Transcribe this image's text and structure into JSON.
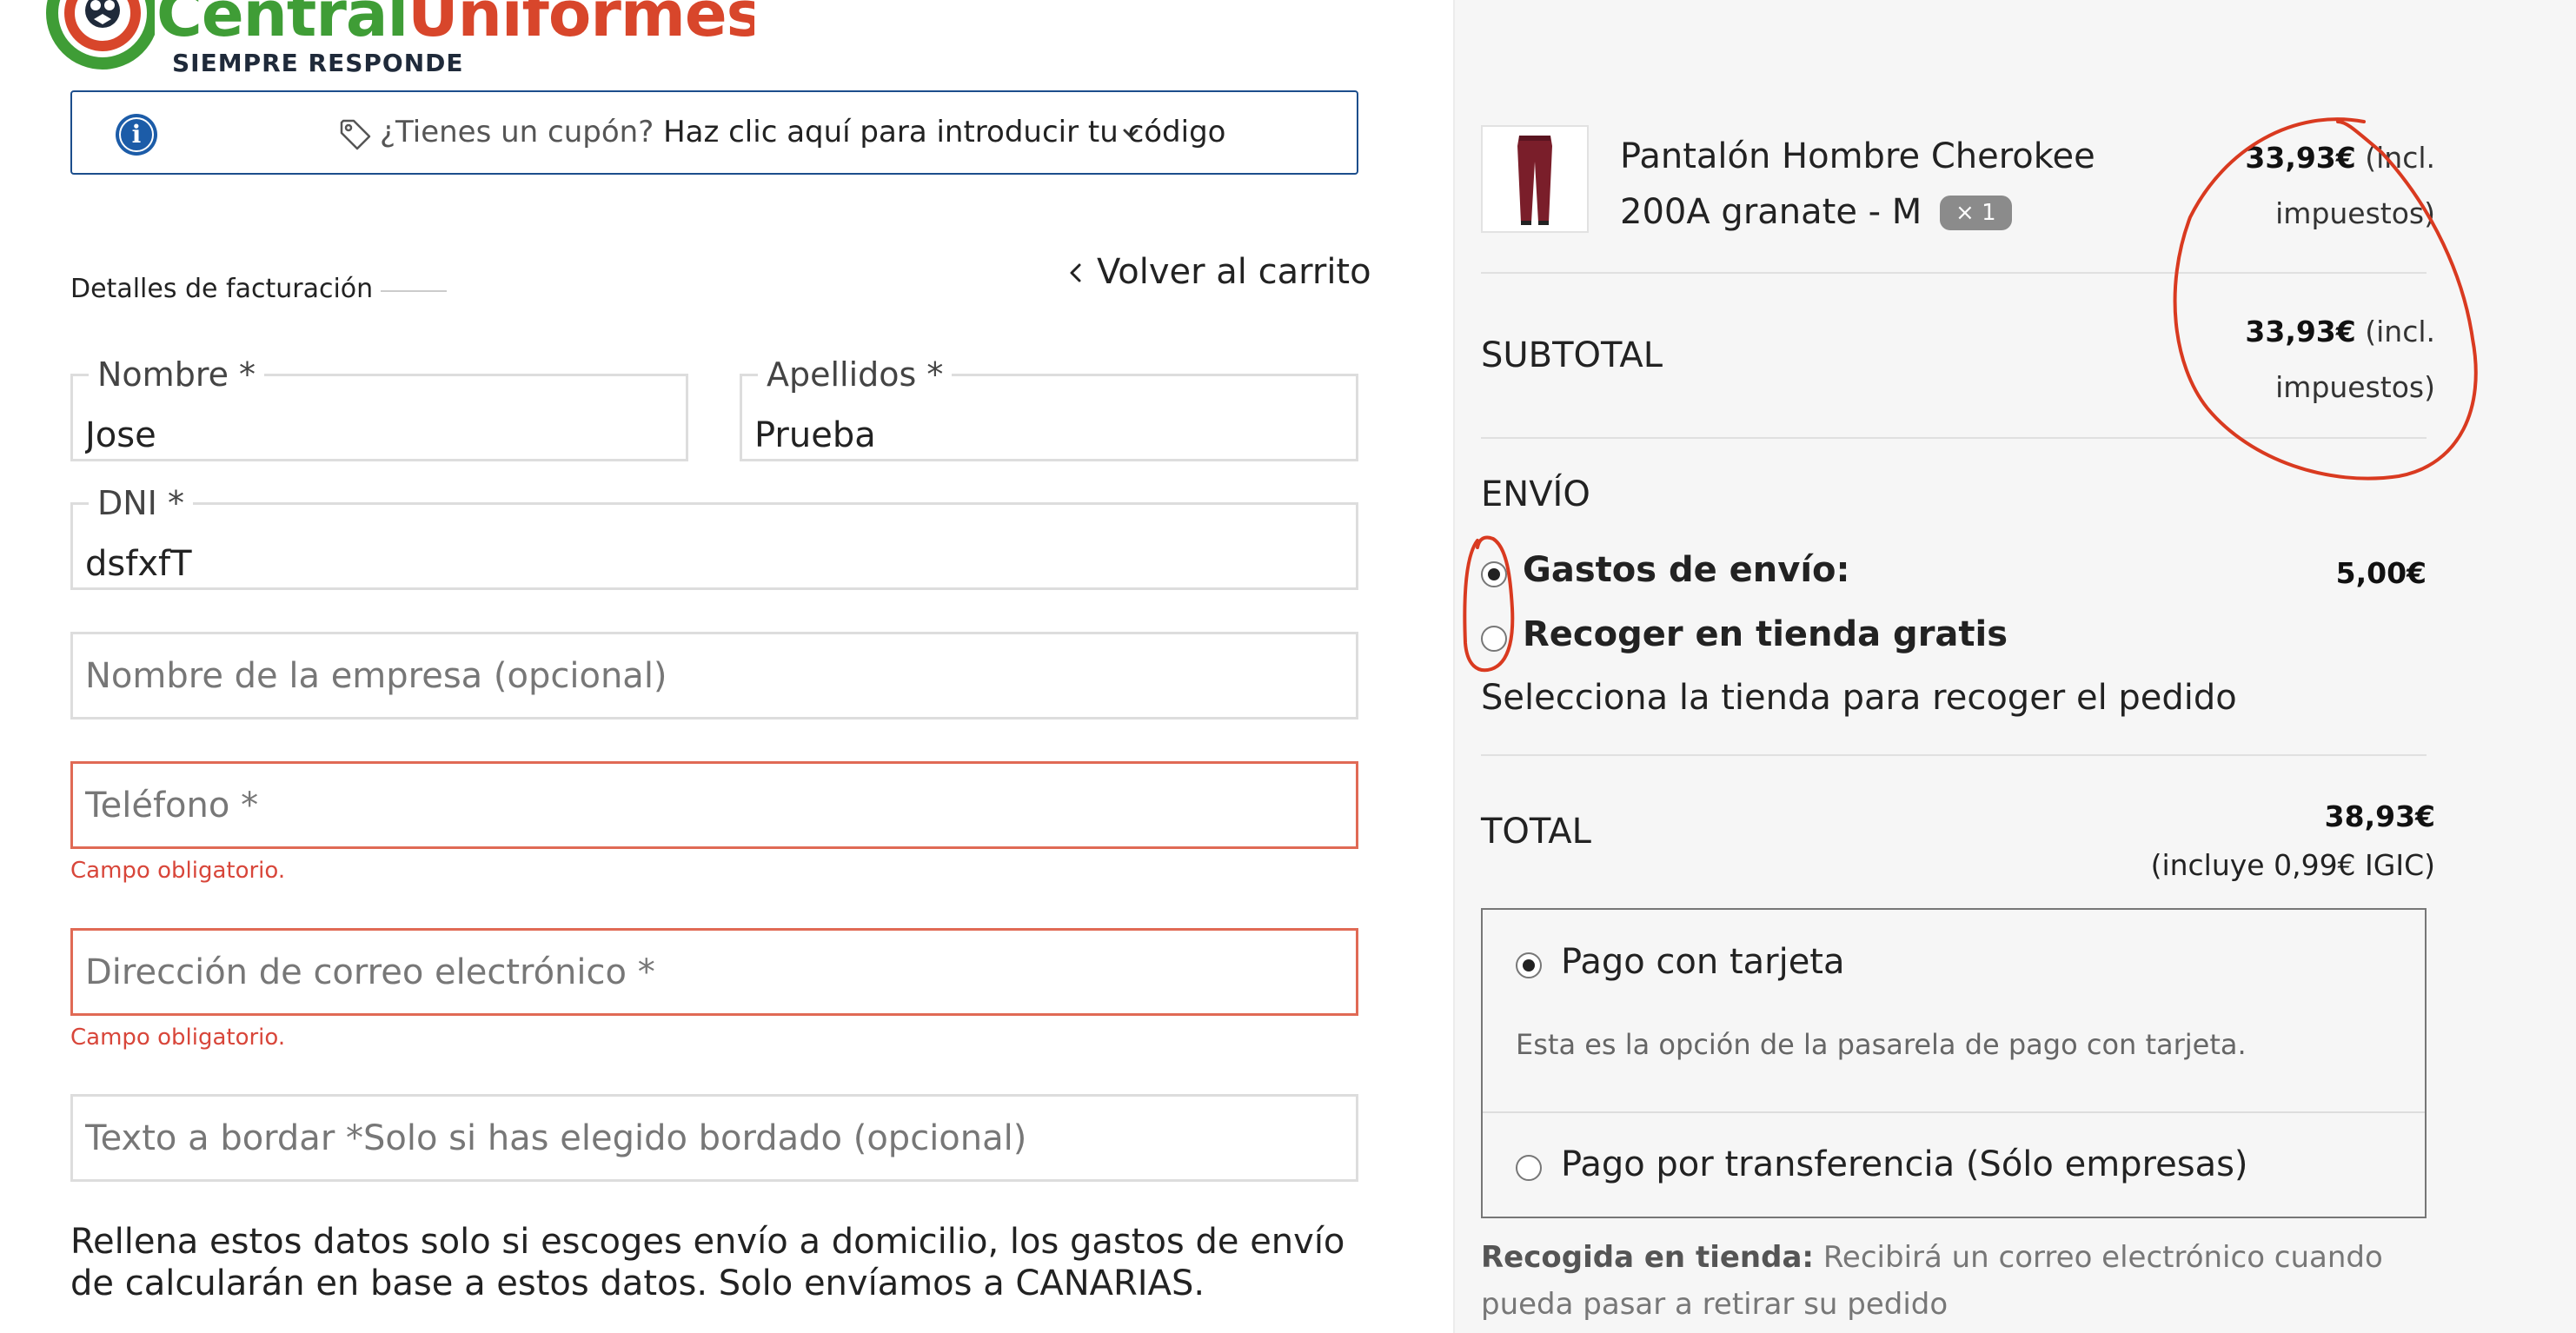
{
  "brand": {
    "name_part1": "Central",
    "name_part2": "Uniformes",
    "tagline": "SIEMPRE RESPONDE"
  },
  "coupon": {
    "question": "¿Tienes un cupón?",
    "link": "Haz clic aquí para introducir tu código"
  },
  "billing": {
    "section_title": "Detalles de facturación",
    "back_link": "Volver al carrito",
    "nombre": {
      "label": "Nombre *",
      "value": "Jose"
    },
    "apellidos": {
      "label": "Apellidos *",
      "value": "Prueba"
    },
    "dni": {
      "label": "DNI *",
      "value": "dsfxfT"
    },
    "empresa": {
      "placeholder": "Nombre de la empresa (opcional)"
    },
    "telefono": {
      "placeholder": "Teléfono *",
      "error": "Campo obligatorio."
    },
    "email": {
      "placeholder": "Dirección de correo electrónico *",
      "error": "Campo obligatorio."
    },
    "bordado": {
      "placeholder": "Texto a bordar *Solo si has elegido bordado (opcional)"
    },
    "note": "Rellena estos datos solo si escoges envío a domicilio, los gastos de envío de calcularán en base a estos datos. Solo envíamos a CANARIAS."
  },
  "order": {
    "product": {
      "name": "Pantalón Hombre Cherokee 200A granate - M",
      "qty": "× 1",
      "price": "33,93€",
      "tax_note_1": "(incl.",
      "tax_note_2": "impuestos)"
    },
    "subtotal": {
      "label": "SUBTOTAL",
      "price": "33,93€",
      "tax_note_1": "(incl.",
      "tax_note_2": "impuestos)"
    },
    "shipping": {
      "label": "ENVÍO",
      "options": [
        {
          "label": "Gastos de envío:",
          "price": "5,00€",
          "selected": true
        },
        {
          "label": "Recoger en tienda gratis",
          "price": "",
          "selected": false
        }
      ],
      "hint": "Selecciona la tienda para recoger el pedido"
    },
    "total": {
      "label": "TOTAL",
      "price": "38,93€",
      "tax_note": "(incluye 0,99€ IGIC)"
    },
    "payment": {
      "options": [
        {
          "label": "Pago con tarjeta",
          "selected": true,
          "description": "Esta es la opción de la pasarela de pago con tarjeta."
        },
        {
          "label": "Pago por transferencia (Sólo empresas)",
          "selected": false
        }
      ]
    },
    "pickup_note": {
      "bold": "Recogida en tienda:",
      "text": "Recibirá un correo electrónico cuando pueda pasar a retirar su pedido"
    }
  },
  "colors": {
    "brand_green": "#3f9d36",
    "brand_red": "#d8462b",
    "coupon_border": "#1c4e8c",
    "error": "#d8463a",
    "annotation": "#d93a20"
  }
}
